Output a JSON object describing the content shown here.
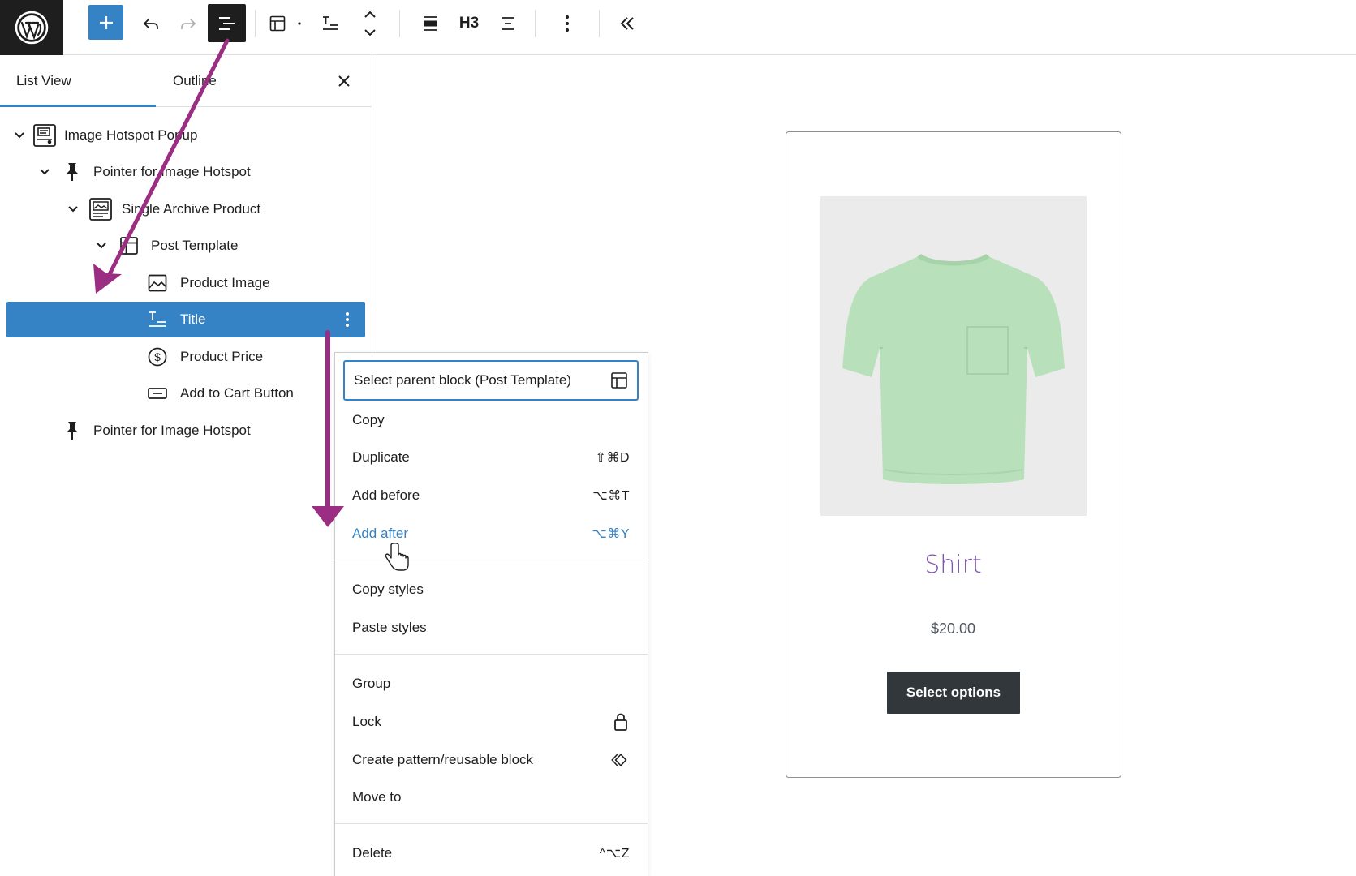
{
  "toolbar": {
    "heading_level": "H3"
  },
  "list_view": {
    "tabs": [
      "List View",
      "Outline"
    ],
    "items": [
      {
        "label": "Image Hotspot Popup",
        "icon": "image-hotspot-popup-icon",
        "expanded": true
      },
      {
        "label": "Pointer for Image Hotspot",
        "icon": "pin-icon",
        "expanded": true
      },
      {
        "label": "Single Archive Product",
        "icon": "archive-product-icon",
        "expanded": true
      },
      {
        "label": "Post Template",
        "icon": "layout-icon",
        "expanded": true
      },
      {
        "label": "Product Image",
        "icon": "image-icon"
      },
      {
        "label": "Title",
        "icon": "title-icon",
        "selected": true
      },
      {
        "label": "Product Price",
        "icon": "currency-dollar-icon"
      },
      {
        "label": "Add to Cart Button",
        "icon": "button-icon"
      },
      {
        "label": "Pointer for Image Hotspot",
        "icon": "pin-icon"
      }
    ]
  },
  "menu": {
    "items": [
      {
        "label": "Select parent block (Post Template)",
        "icon": "layout-icon"
      },
      {
        "label": "Copy"
      },
      {
        "label": "Duplicate",
        "shortcut": "⇧⌘D"
      },
      {
        "label": "Add before",
        "shortcut": "⌥⌘T"
      },
      {
        "label": "Add after",
        "shortcut": "⌥⌘Y"
      },
      {
        "label": "Copy styles"
      },
      {
        "label": "Paste styles"
      },
      {
        "label": "Group"
      },
      {
        "label": "Lock",
        "icon": "lock-icon"
      },
      {
        "label": "Create pattern/reusable block",
        "icon": "pattern-icon"
      },
      {
        "label": "Move to"
      },
      {
        "label": "Delete",
        "shortcut": "^⌥Z"
      }
    ]
  },
  "product": {
    "title": "Shirt",
    "price": "$20.00",
    "button_label": "Select options"
  },
  "colors": {
    "accent": "#3582c4",
    "annotation_arrow": "#9b2d82",
    "product_title": "#7f54b3",
    "shirt": "#b8e0bb"
  }
}
